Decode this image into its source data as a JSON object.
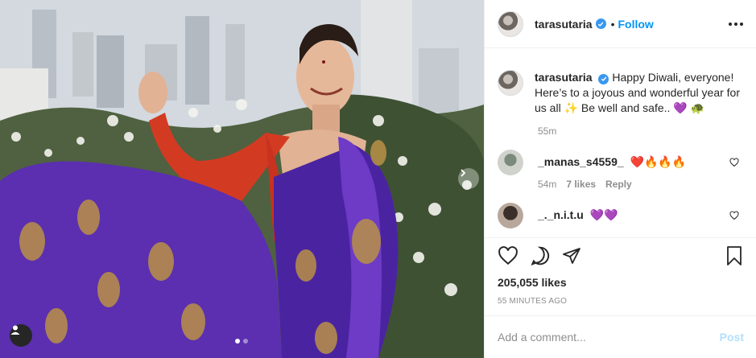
{
  "post": {
    "username": "tarasutaria",
    "separator": "•",
    "follow_label": "Follow",
    "caption": "Happy Diwali, everyone! Here’s to a joyous and wonderful year for us all ✨ Be well and safe.. 💜 🐢",
    "caption_time": "55m"
  },
  "comments": [
    {
      "username": "_manas_s4559_",
      "text": "❤️🔥🔥🔥",
      "time": "54m",
      "likes": "7 likes",
      "reply_label": "Reply"
    },
    {
      "username": "_._n.i.t.u",
      "text": "💜💜"
    }
  ],
  "likes": "205,055 likes",
  "posted_ago": "55 MINUTES AGO",
  "add_comment": {
    "placeholder": "Add a comment...",
    "post_label": "Post"
  },
  "colors": {
    "accent": "#0095f6",
    "verified": "#3897f0",
    "post_disabled": "#b2dffc",
    "saree": "#5b2fb0"
  },
  "icons": [
    "verified-icon",
    "more-options-icon",
    "heart-icon",
    "comment-icon",
    "share-icon",
    "bookmark-icon",
    "user-tag-icon",
    "next-arrow-icon"
  ]
}
